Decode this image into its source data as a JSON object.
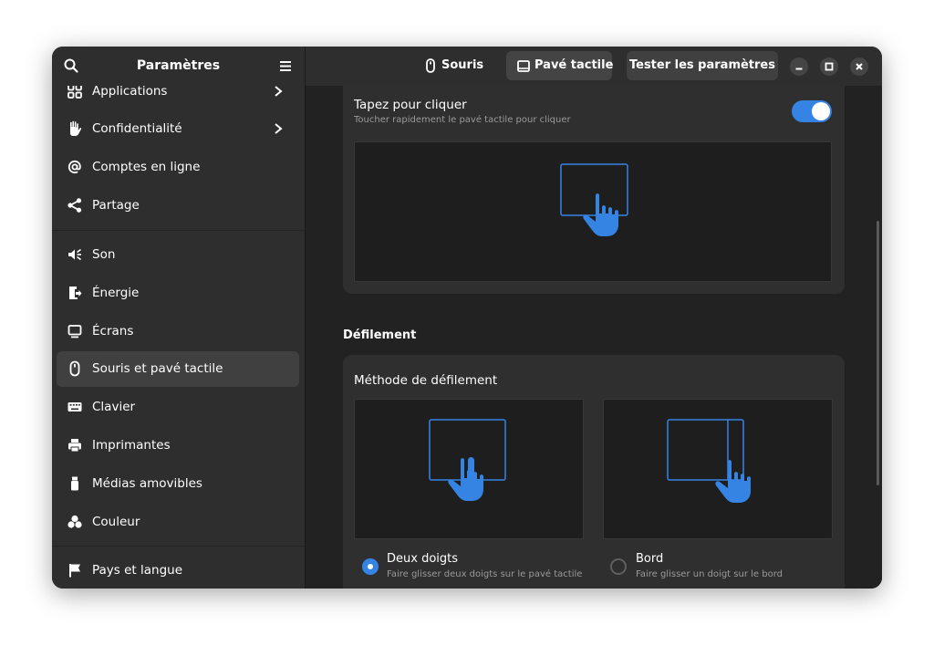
{
  "app": {
    "title": "Paramètres"
  },
  "sidebar": {
    "items": [
      {
        "label": "Applications",
        "icon": "apps-icon",
        "chevron": true
      },
      {
        "label": "Confidentialité",
        "icon": "hand-icon",
        "chevron": true
      },
      {
        "label": "Comptes en ligne",
        "icon": "at-icon",
        "chevron": false
      },
      {
        "label": "Partage",
        "icon": "share-icon",
        "chevron": false
      },
      {
        "label": "Son",
        "icon": "speaker-icon",
        "chevron": false
      },
      {
        "label": "Énergie",
        "icon": "battery-icon",
        "chevron": false
      },
      {
        "label": "Écrans",
        "icon": "display-icon",
        "chevron": false
      },
      {
        "label": "Souris et pavé tactile",
        "icon": "mouse-icon",
        "chevron": false,
        "active": true
      },
      {
        "label": "Clavier",
        "icon": "keyboard-icon",
        "chevron": false
      },
      {
        "label": "Imprimantes",
        "icon": "printer-icon",
        "chevron": false
      },
      {
        "label": "Médias amovibles",
        "icon": "usb-icon",
        "chevron": false
      },
      {
        "label": "Couleur",
        "icon": "color-icon",
        "chevron": false
      },
      {
        "label": "Pays et langue",
        "icon": "flag-icon",
        "chevron": false
      }
    ]
  },
  "header": {
    "tabs": [
      {
        "label": "Souris",
        "icon": "mouse-icon",
        "selected": false
      },
      {
        "label": "Pavé tactile",
        "icon": "touchpad-icon",
        "selected": true
      }
    ],
    "test_button": "Tester les paramètres"
  },
  "tap_to_click": {
    "title": "Tapez pour cliquer",
    "subtitle": "Toucher rapidement le pavé tactile pour cliquer",
    "enabled": true
  },
  "scrolling": {
    "section_title": "Défilement",
    "method_title": "Méthode de défilement",
    "options": [
      {
        "title": "Deux doigts",
        "subtitle": "Faire glisser deux doigts sur le pavé tactile",
        "selected": true
      },
      {
        "title": "Bord",
        "subtitle": "Faire glisser un doigt sur le bord",
        "selected": false
      }
    ]
  },
  "colors": {
    "accent": "#3584e4",
    "sidebar_bg": "#2e2e2e",
    "content_bg": "#222222",
    "card_bg": "#2f2f2f"
  }
}
